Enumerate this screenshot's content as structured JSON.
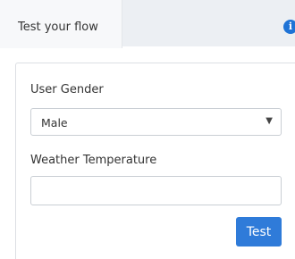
{
  "tabs": [
    {
      "label": "Test your flow",
      "active": true
    }
  ],
  "info_icon": {
    "glyph": "i",
    "icon": "info-icon",
    "color": "#1f73d6"
  },
  "form": {
    "gender": {
      "label": "User Gender",
      "selected": "Male",
      "chevron": "▼"
    },
    "temperature": {
      "label": "Weather Temperature",
      "value": "",
      "placeholder": ""
    },
    "submit_label": "Test",
    "accent_color": "#2f7bd9"
  }
}
